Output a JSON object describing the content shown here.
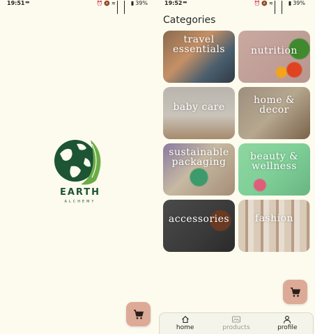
{
  "left_screen": {
    "status": {
      "time": "19:51",
      "battery": "39%"
    },
    "brand": {
      "name": "EARTH",
      "tagline": "ALCHEMY"
    }
  },
  "right_screen": {
    "status": {
      "time": "19:52",
      "battery": "39%"
    },
    "title": "Categories",
    "categories": [
      {
        "label": "travel essentials"
      },
      {
        "label": "nutrition"
      },
      {
        "label": "baby care"
      },
      {
        "label": "home & decor"
      },
      {
        "label": "sustainable packaging"
      },
      {
        "label": "beauty & wellness"
      },
      {
        "label": "accessories"
      },
      {
        "label": "fashion"
      }
    ],
    "nav": [
      {
        "label": "home",
        "icon": "home-icon"
      },
      {
        "label": "products",
        "icon": "products-icon"
      },
      {
        "label": "profile",
        "icon": "profile-icon"
      }
    ]
  },
  "colors": {
    "background": "#fcfbee",
    "cart_fab": "#ddaa97",
    "brand_green": "#1d5434"
  }
}
